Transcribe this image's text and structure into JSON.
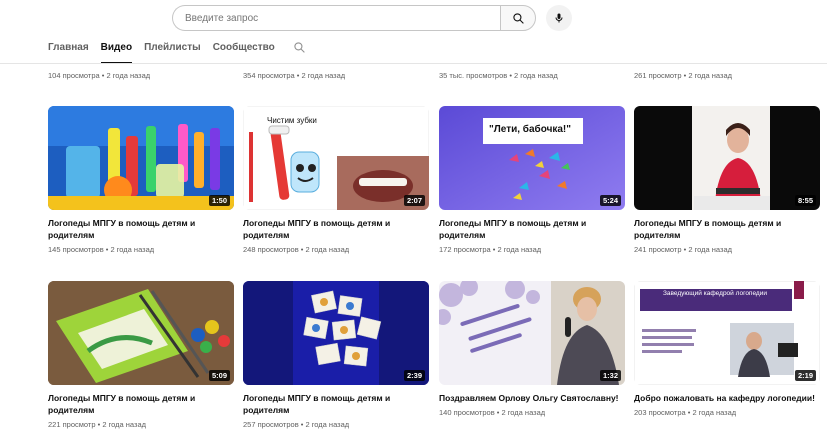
{
  "search": {
    "placeholder": "Введите запрос"
  },
  "icons": {
    "search": "search-icon",
    "mic": "microphone-icon",
    "tab_search": "search-icon"
  },
  "tabs": [
    {
      "label": "Главная",
      "active": false
    },
    {
      "label": "Видео",
      "active": true
    },
    {
      "label": "Плейлисты",
      "active": false
    },
    {
      "label": "Сообщество",
      "active": false
    }
  ],
  "partial_row": [
    {
      "meta": "104 просмотра • 2 года назад"
    },
    {
      "meta": "354 просмотра • 2 года назад"
    },
    {
      "meta": "35 тыс. просмотров • 2 года назад"
    },
    {
      "meta": "261 просмотр • 2 года назад"
    }
  ],
  "videos": [
    {
      "title": "Логопеды МПГУ в помощь детям и родителям",
      "meta": "145 просмотров • 2 года назад",
      "duration": "1:50"
    },
    {
      "title": "Логопеды МПГУ в помощь детям и родителям",
      "meta": "248 просмотров • 2 года назад",
      "duration": "2:07",
      "thumb_text": "Чистим зубки"
    },
    {
      "title": "Логопеды МПГУ в помощь детям и родителям",
      "meta": "172 просмотра • 2 года назад",
      "duration": "5:24",
      "thumb_text": "\"Лети, бабочка!\""
    },
    {
      "title": "Логопеды МПГУ в помощь детям и родителям",
      "meta": "241 просмотр • 2 года назад",
      "duration": "8:55"
    },
    {
      "title": "Логопеды МПГУ в помощь детям и родителям",
      "meta": "221 просмотр • 2 года назад",
      "duration": "5:09"
    },
    {
      "title": "Логопеды МПГУ в помощь детям и родителям",
      "meta": "257 просмотров • 2 года назад",
      "duration": "2:39"
    },
    {
      "title": "Поздравляем Орлову Ольгу Святославну!",
      "meta": "140 просмотров • 2 года назад",
      "duration": "1:32"
    },
    {
      "title": "Добро пожаловать на кафедру логопедии!",
      "meta": "203 просмотра • 2 года назад",
      "duration": "2:19",
      "thumb_text": "Заведующий кафедрой логопедии"
    }
  ]
}
